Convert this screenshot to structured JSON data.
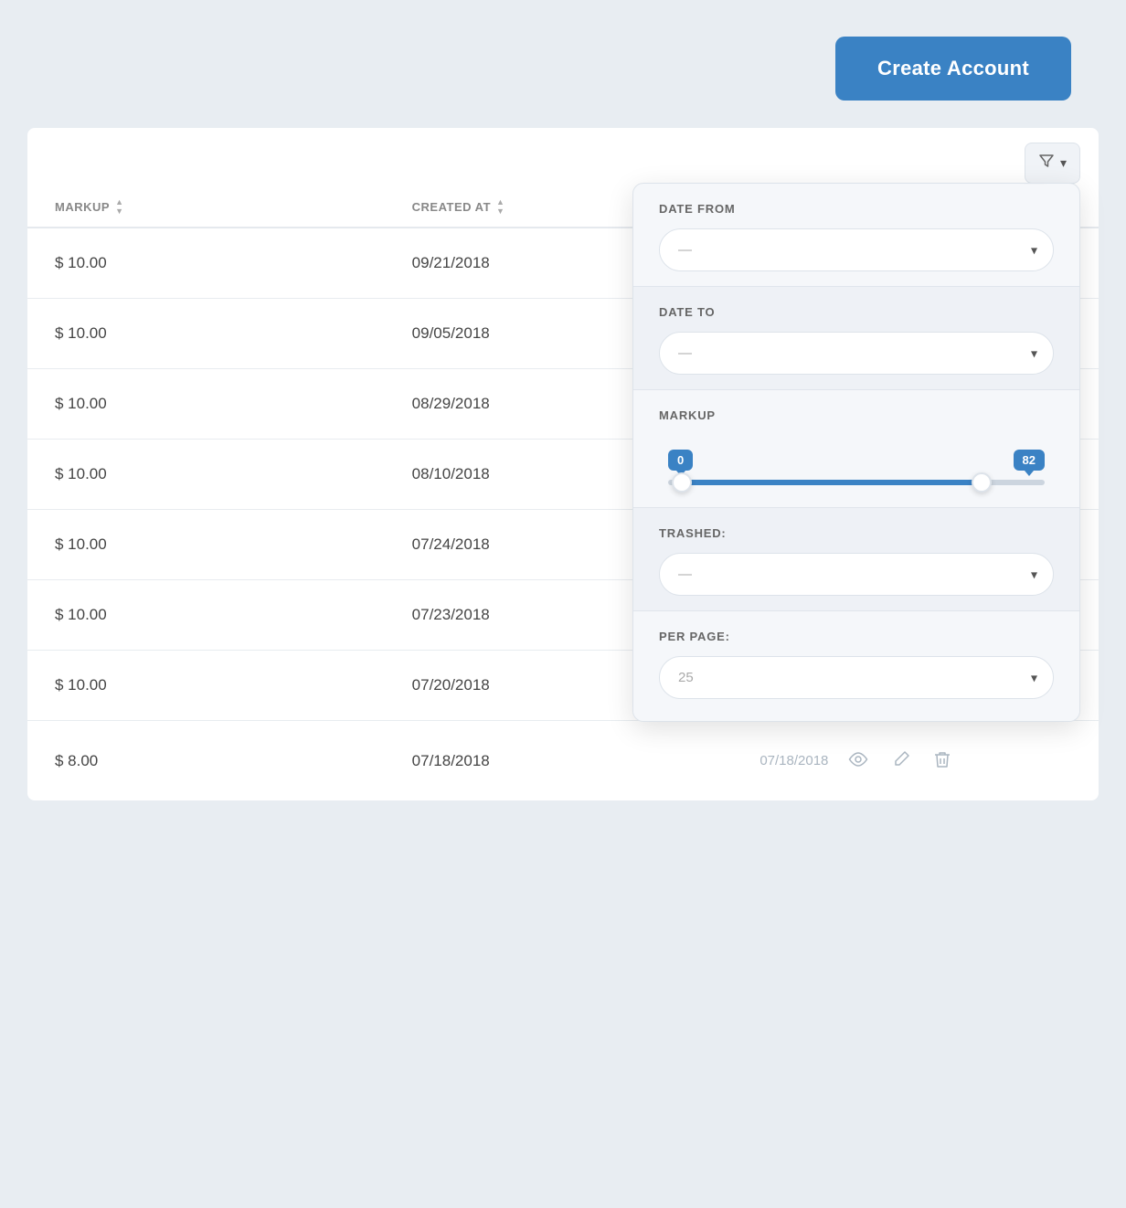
{
  "header": {
    "create_account_label": "Create Account"
  },
  "filter_button": {
    "label": "▼"
  },
  "table": {
    "columns": [
      {
        "key": "markup",
        "label": "MARKUP"
      },
      {
        "key": "created_at",
        "label": "CREATED AT"
      }
    ],
    "rows": [
      {
        "markup": "$ 10.00",
        "created_at": "09/21/2018"
      },
      {
        "markup": "$ 10.00",
        "created_at": "09/05/2018"
      },
      {
        "markup": "$ 10.00",
        "created_at": "08/29/2018"
      },
      {
        "markup": "$ 10.00",
        "created_at": "08/10/2018"
      },
      {
        "markup": "$ 10.00",
        "created_at": "07/24/2018"
      },
      {
        "markup": "$ 10.00",
        "created_at": "07/23/2018"
      },
      {
        "markup": "$ 10.00",
        "created_at": "07/20/2018"
      },
      {
        "markup": "$ 8.00",
        "created_at": "07/18/2018"
      }
    ],
    "last_row_date": "07/18/2018"
  },
  "filter_panel": {
    "date_from_label": "DATE FROM",
    "date_from_placeholder": "—",
    "date_to_label": "DATE TO",
    "date_to_placeholder": "—",
    "markup_label": "MARKUP",
    "markup_min": "0",
    "markup_max": "82",
    "trashed_label": "TRASHED:",
    "trashed_placeholder": "—",
    "per_page_label": "PER PAGE:",
    "per_page_value": "25"
  },
  "icons": {
    "filter": "⛉",
    "chevron_down": "▾",
    "view": "👁",
    "edit": "✎",
    "trash": "🗑"
  }
}
